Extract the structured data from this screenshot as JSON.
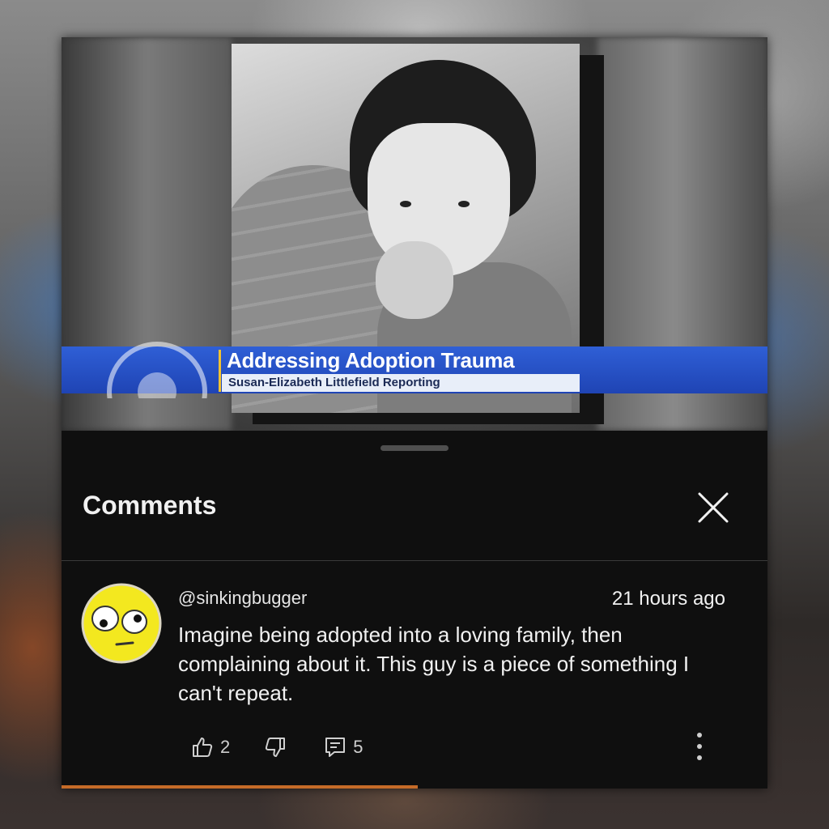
{
  "video": {
    "headline": "Addressing Adoption Trauma",
    "reporter": "Susan-Elizabeth Littlefield Reporting"
  },
  "comments_panel": {
    "title": "Comments",
    "close_icon": "close-icon"
  },
  "comment": {
    "username": "@sinkingbugger",
    "timestamp": "21 hours ago",
    "text": "Imagine being adopted into a loving family, then complaining about it. This guy is a piece of something I can't repeat.",
    "avatar_icon": "googly-eyed-face-icon",
    "likes": "2",
    "replies": "5",
    "like_icon": "thumbs-up-icon",
    "dislike_icon": "thumbs-down-icon",
    "reply_icon": "reply-icon",
    "more_icon": "more-vertical-icon"
  },
  "colors": {
    "panel_bg": "#0f0f0f",
    "banner_blue": "#2a56cc",
    "avatar_yellow": "#f3e81f",
    "text_primary": "#f1f1f1"
  }
}
